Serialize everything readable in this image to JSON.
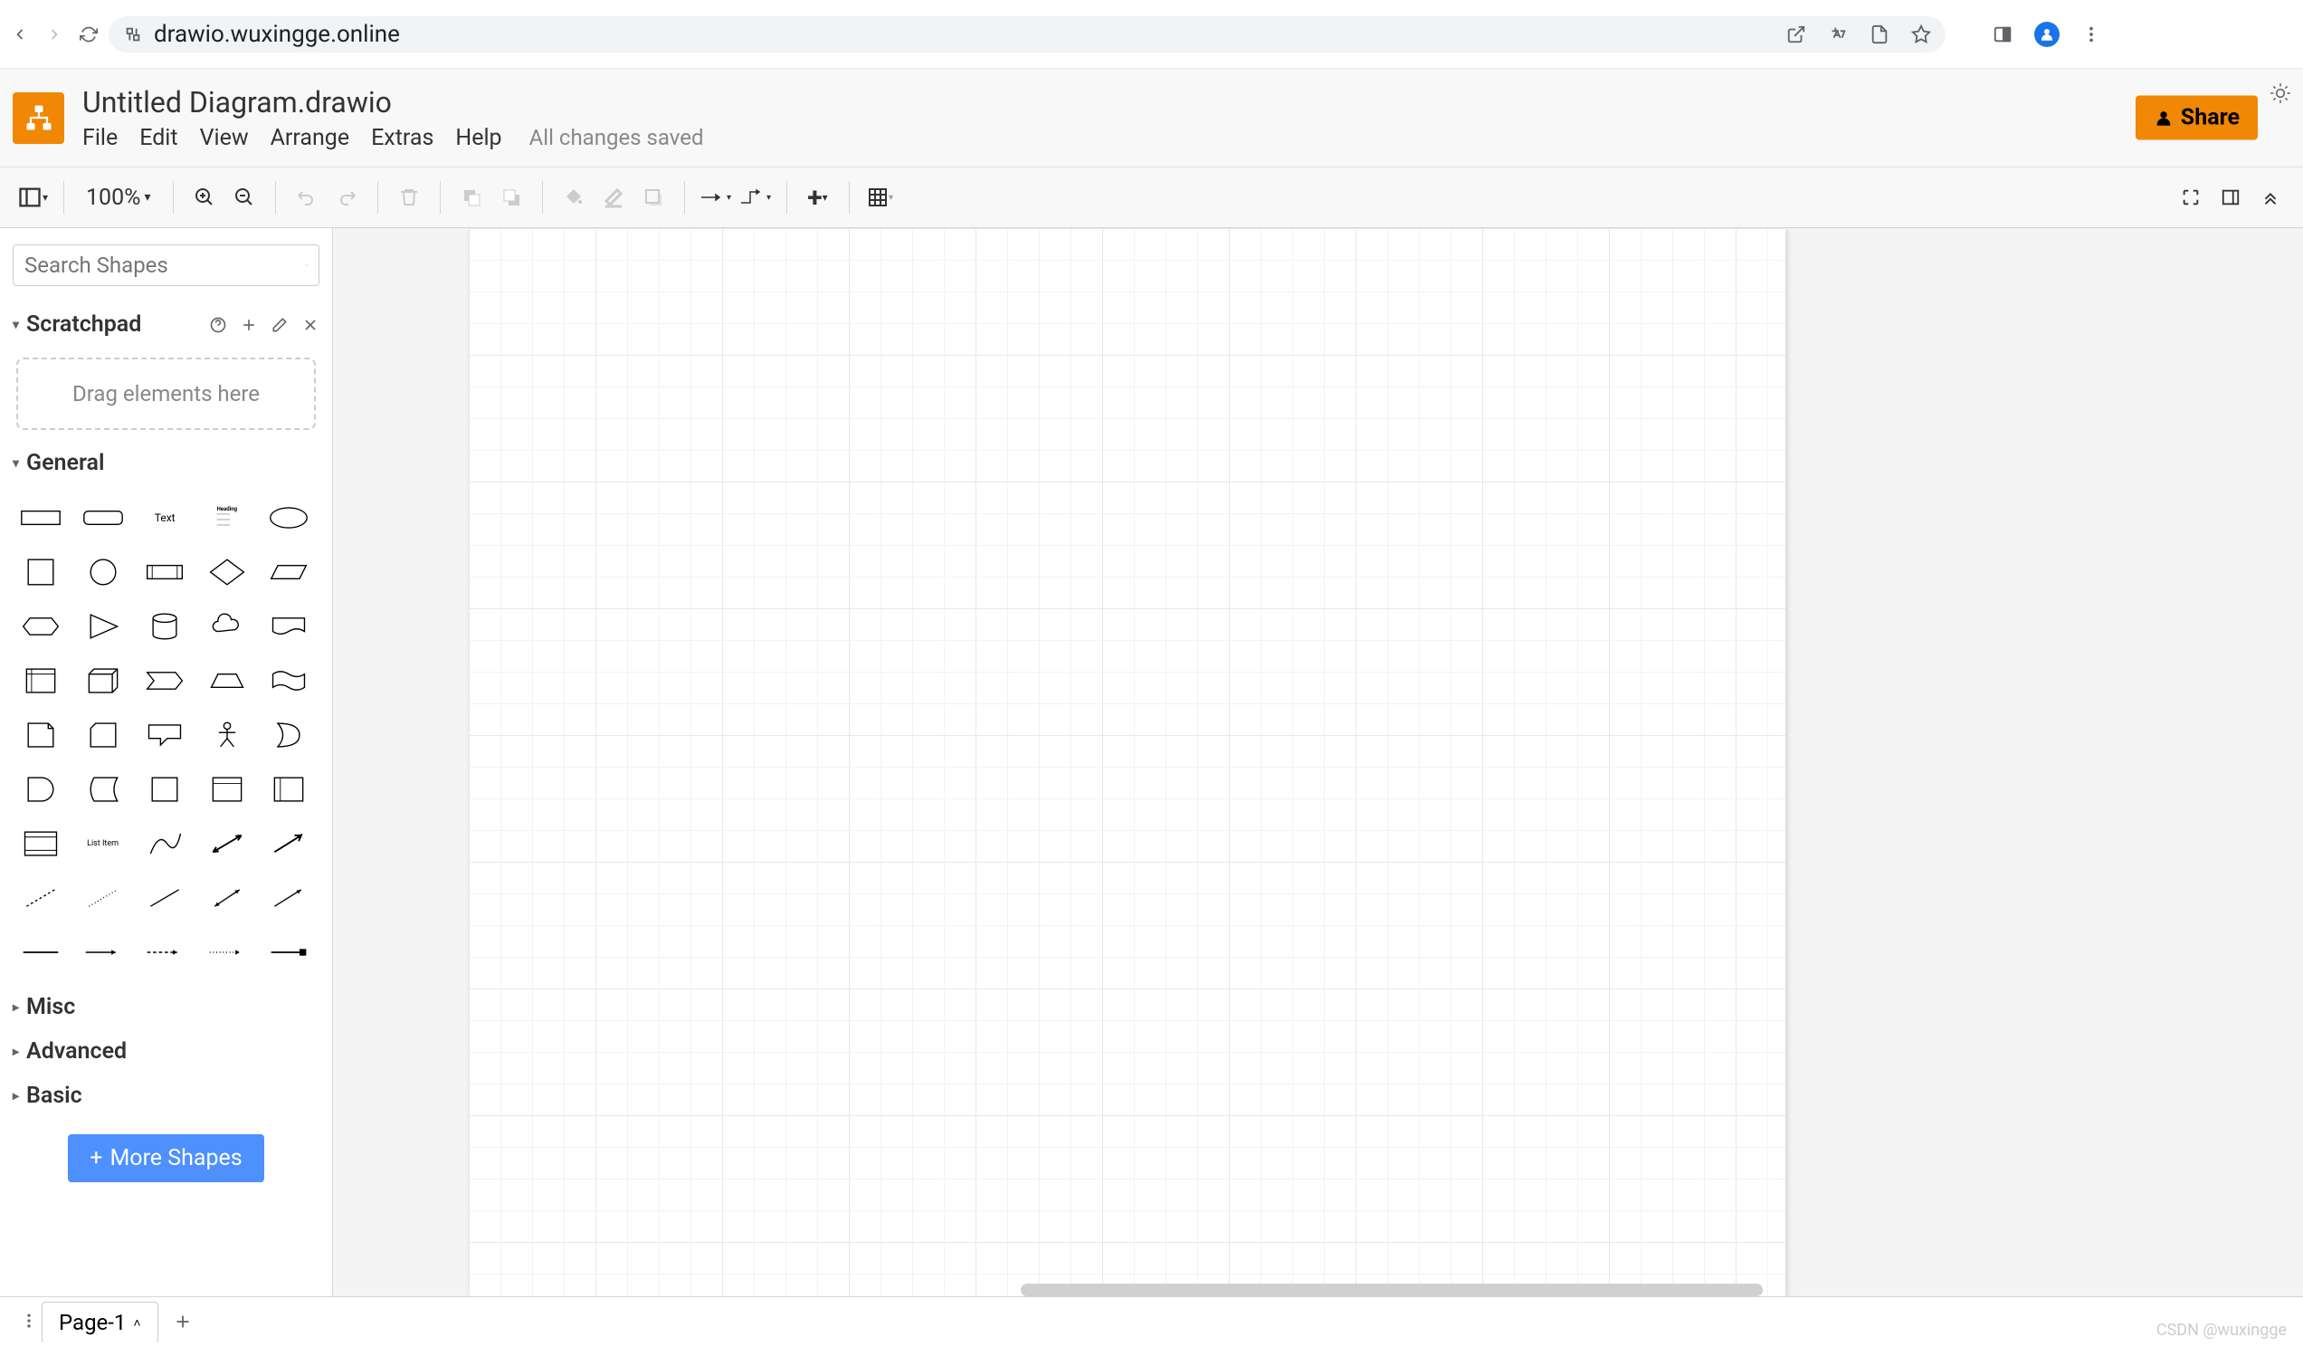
{
  "browser": {
    "url": "drawio.wuxingge.online"
  },
  "header": {
    "title": "Untitled Diagram.drawio",
    "menus": [
      "File",
      "Edit",
      "View",
      "Arrange",
      "Extras",
      "Help"
    ],
    "save_status": "All changes saved",
    "share_label": "Share"
  },
  "toolbar": {
    "zoom": "100%"
  },
  "sidebar": {
    "search_placeholder": "Search Shapes",
    "scratchpad": {
      "label": "Scratchpad",
      "drop_hint": "Drag elements here"
    },
    "sections": {
      "general": "General",
      "misc": "Misc",
      "advanced": "Advanced",
      "basic": "Basic"
    },
    "more_shapes": "More Shapes",
    "shape_labels": {
      "text": "Text",
      "heading": "Heading",
      "list_item": "List Item"
    }
  },
  "footer": {
    "page_tab": "Page-1",
    "watermark": "CSDN @wuxingge"
  }
}
